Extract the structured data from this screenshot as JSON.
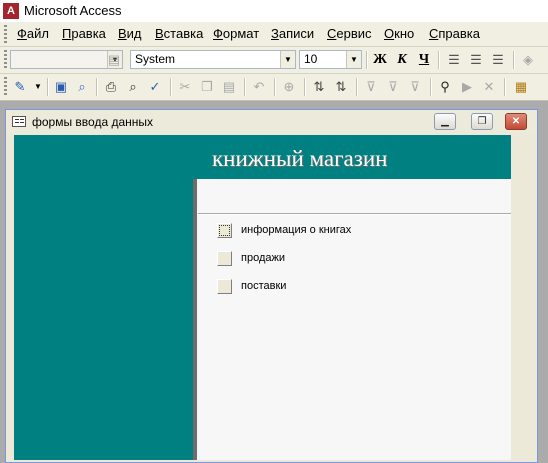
{
  "app": {
    "title": "Microsoft Access"
  },
  "menu": [
    "Файл",
    "Правка",
    "Вид",
    "Вставка",
    "Формат",
    "Записи",
    "Сервис",
    "Окно",
    "Справка"
  ],
  "format_toolbar": {
    "object_combo": "",
    "font_combo": "System",
    "size_combo": "10",
    "bold": "Ж",
    "italic": "К",
    "underline": "Ч"
  },
  "form_window": {
    "title": "формы ввода данных",
    "header": "книжный магазин",
    "options": [
      {
        "label": "информация о книгах",
        "focused": true
      },
      {
        "label": "продажи",
        "focused": false
      },
      {
        "label": "поставки",
        "focused": false
      }
    ]
  },
  "colors": {
    "teal": "#008080",
    "mdi_background": "#ababab"
  }
}
